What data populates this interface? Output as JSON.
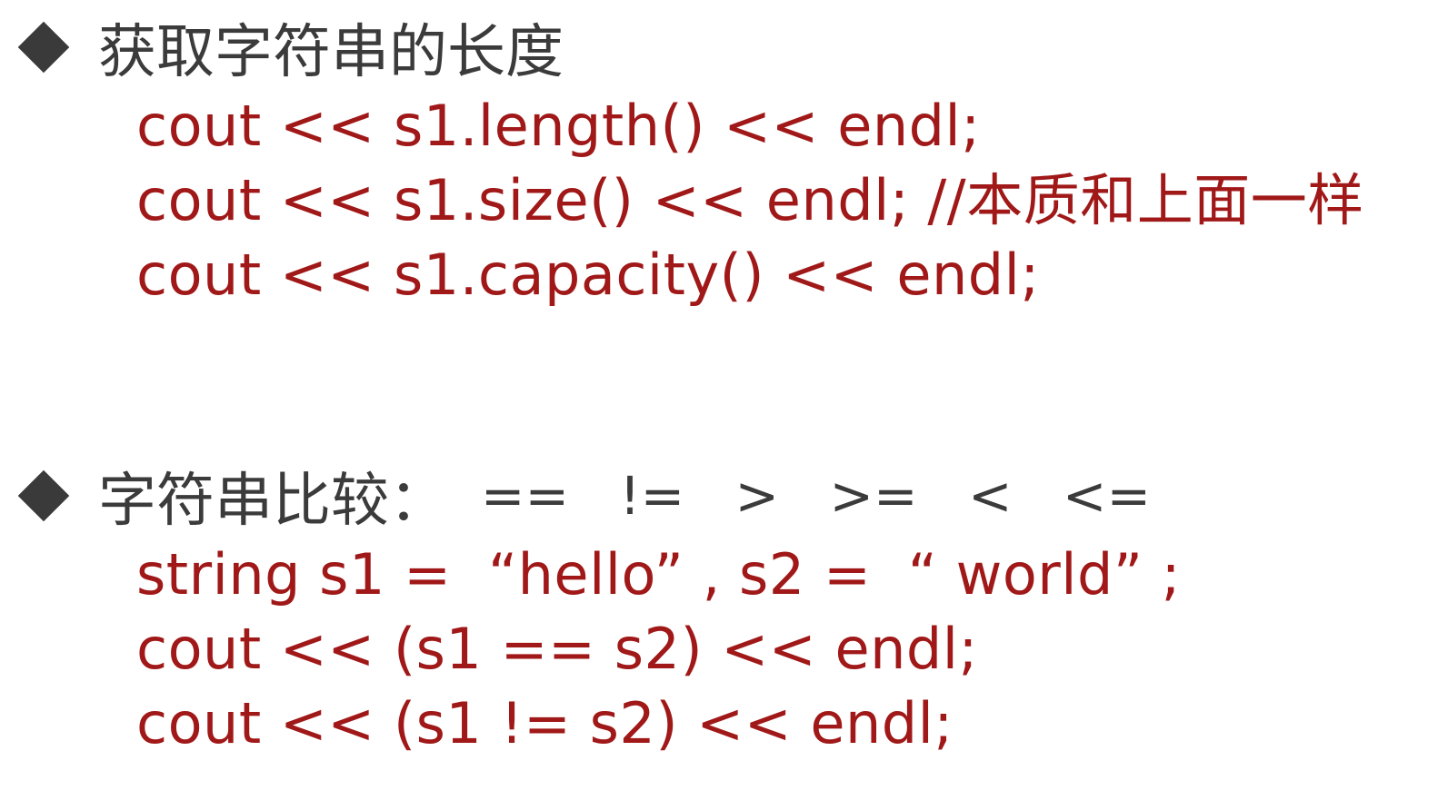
{
  "section1": {
    "heading": "获取字符串的长度",
    "lines": [
      "cout << s1.length() << endl;",
      "cout << s1.size() << endl; //本质和上面一样",
      "cout << s1.capacity() << endl;"
    ]
  },
  "section2": {
    "heading": "字符串比较：",
    "operators": "  ==   !=   >   >=   <   <=",
    "lines": [
      "string s1 =  “hello” , s2 =  “ world” ;",
      "cout << (s1 == s2) << endl;",
      "cout << (s1 != s2) << endl;"
    ]
  },
  "colors": {
    "heading": "#3b3b3b",
    "code": "#a01818",
    "bullet": "#3a3a3a"
  }
}
